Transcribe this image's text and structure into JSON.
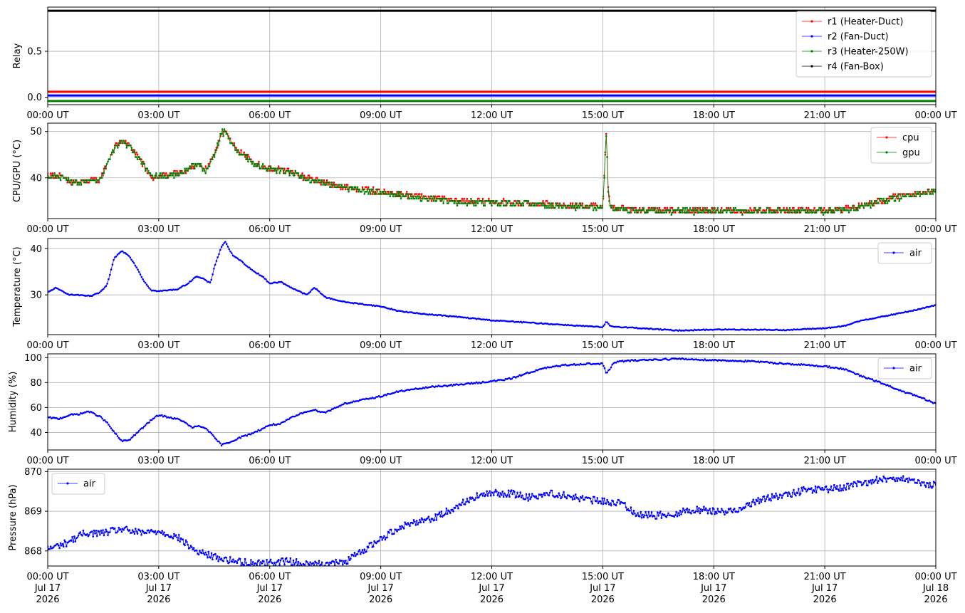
{
  "colors": {
    "red": "#ff0000",
    "blue": "#0000ff",
    "green": "#008000",
    "black": "#000000",
    "grid": "#b0b0b0"
  },
  "x_axis": {
    "ticks_hours": [
      0,
      3,
      6,
      9,
      12,
      15,
      18,
      21,
      24
    ],
    "tick_labels": [
      "00:00 UT",
      "03:00 UT",
      "06:00 UT",
      "09:00 UT",
      "12:00 UT",
      "15:00 UT",
      "18:00 UT",
      "21:00 UT",
      "00:00 UT"
    ],
    "date_lines": [
      "Jul 17",
      "Jul 17",
      "Jul 17",
      "Jul 17",
      "Jul 17",
      "Jul 17",
      "Jul 17",
      "Jul 17",
      "Jul 18"
    ],
    "year_lines": [
      "2026",
      "2026",
      "2026",
      "2026",
      "2026",
      "2026",
      "2026",
      "2026",
      "2026"
    ],
    "xlim_hours": [
      0,
      24
    ]
  },
  "chart_data": [
    {
      "type": "line",
      "ylabel": "Relay",
      "ylim": [
        -0.08,
        0.98
      ],
      "yticks": [
        0.0,
        0.5
      ],
      "ytick_labels": [
        "0.0",
        "0.5"
      ],
      "grid": true,
      "legend_position": "top-right",
      "series": [
        {
          "name": "r1 (Heater-Duct)",
          "color": "#ff0000",
          "style": "flat",
          "x": [
            0,
            24
          ],
          "y": [
            0.06,
            0.06
          ]
        },
        {
          "name": "r2 (Fan-Duct)",
          "color": "#0000ff",
          "style": "flat",
          "x": [
            0,
            24
          ],
          "y": [
            0.02,
            0.02
          ]
        },
        {
          "name": "r3 (Heater-250W)",
          "color": "#008000",
          "style": "flat",
          "x": [
            0,
            24
          ],
          "y": [
            -0.04,
            -0.04
          ]
        },
        {
          "name": "r4 (Fan-Box)",
          "color": "#000000",
          "style": "flat",
          "x": [
            0,
            24
          ],
          "y": [
            0.94,
            0.94
          ]
        }
      ]
    },
    {
      "type": "line",
      "ylabel": "CPU/GPU (°C)",
      "ylim": [
        31.2,
        51.8
      ],
      "yticks": [
        40,
        50
      ],
      "ytick_labels": [
        "40",
        "50"
      ],
      "grid": true,
      "legend_position": "top-right",
      "series": [
        {
          "name": "cpu",
          "color": "#ff0000",
          "style": "dense",
          "noise": 0.6,
          "x": [
            0,
            0.3,
            0.6,
            1.0,
            1.4,
            1.6,
            1.8,
            2.0,
            2.2,
            2.5,
            2.8,
            3.2,
            3.6,
            3.9,
            4.1,
            4.3,
            4.5,
            4.7,
            4.8,
            5.0,
            5.3,
            5.6,
            6.0,
            6.5,
            7.0,
            7.5,
            8.0,
            8.5,
            9.0,
            10.0,
            11.0,
            12.0,
            13.0,
            14.0,
            15.0,
            15.06,
            15.1,
            15.14,
            15.2,
            15.3,
            16.0,
            17.0,
            18.0,
            19.0,
            20.0,
            21.0,
            21.5,
            22.0,
            22.5,
            23.0,
            23.5,
            24.0
          ],
          "y": [
            40.5,
            40.5,
            39.0,
            39.2,
            39.5,
            43.0,
            46.5,
            48.0,
            47.0,
            44.0,
            40.0,
            40.5,
            41.0,
            42.5,
            43.0,
            41.5,
            45.0,
            50.0,
            50.0,
            47.0,
            45.0,
            43.0,
            42.0,
            41.5,
            40.0,
            39.0,
            38.0,
            37.5,
            37.0,
            36.0,
            35.0,
            34.8,
            34.5,
            34.0,
            33.8,
            44.0,
            51.0,
            38.0,
            34.0,
            33.5,
            33.0,
            33.0,
            33.0,
            33.0,
            33.0,
            33.0,
            33.2,
            34.0,
            35.0,
            36.0,
            36.8,
            37.2
          ]
        },
        {
          "name": "gpu",
          "color": "#008000",
          "style": "dense",
          "noise": 0.6,
          "x": [
            0,
            0.3,
            0.6,
            1.0,
            1.4,
            1.6,
            1.8,
            2.0,
            2.2,
            2.5,
            2.8,
            3.2,
            3.6,
            3.9,
            4.1,
            4.3,
            4.5,
            4.7,
            4.8,
            5.0,
            5.3,
            5.6,
            6.0,
            6.5,
            7.0,
            7.5,
            8.0,
            8.5,
            9.0,
            10.0,
            11.0,
            12.0,
            13.0,
            14.0,
            15.0,
            15.06,
            15.1,
            15.14,
            15.2,
            15.3,
            16.0,
            17.0,
            18.0,
            19.0,
            20.0,
            21.0,
            21.5,
            22.0,
            22.5,
            23.0,
            23.5,
            24.0
          ],
          "y": [
            40.3,
            40.3,
            39.2,
            39.0,
            39.3,
            42.8,
            46.3,
            47.8,
            46.8,
            43.8,
            40.2,
            40.3,
            40.8,
            42.3,
            42.8,
            41.3,
            44.8,
            49.8,
            49.8,
            46.8,
            44.8,
            42.8,
            41.8,
            41.3,
            39.8,
            38.8,
            37.8,
            37.3,
            36.8,
            35.8,
            34.8,
            34.6,
            34.3,
            33.8,
            33.6,
            43.8,
            50.8,
            37.8,
            33.8,
            33.3,
            32.8,
            32.8,
            32.8,
            32.8,
            32.8,
            32.8,
            33.0,
            33.8,
            34.8,
            35.8,
            36.6,
            37.0
          ]
        }
      ]
    },
    {
      "type": "line",
      "ylabel": "Temperature (°C)",
      "ylim": [
        21.4,
        42.2
      ],
      "yticks": [
        30,
        40
      ],
      "ytick_labels": [
        "30",
        "40"
      ],
      "grid": true,
      "legend_position": "top-right",
      "series": [
        {
          "name": "air",
          "color": "#0000ff",
          "style": "smooth",
          "noise": 0.1,
          "x": [
            0,
            0.2,
            0.4,
            0.6,
            0.8,
            1.0,
            1.2,
            1.4,
            1.6,
            1.8,
            2.0,
            2.2,
            2.4,
            2.6,
            2.8,
            3.0,
            3.5,
            3.8,
            4.0,
            4.2,
            4.4,
            4.5,
            4.7,
            4.8,
            5.0,
            5.2,
            5.5,
            5.8,
            6.0,
            6.3,
            6.6,
            7.0,
            7.2,
            7.3,
            7.5,
            8.0,
            8.5,
            9.0,
            9.5,
            10.0,
            11.0,
            12.0,
            13.0,
            14.0,
            15.0,
            15.1,
            15.2,
            16.0,
            17.0,
            18.0,
            19.0,
            20.0,
            21.0,
            21.5,
            22.0,
            22.5,
            23.0,
            23.5,
            24.0
          ],
          "y": [
            30.5,
            31.5,
            30.8,
            30.0,
            30.0,
            29.8,
            29.8,
            30.5,
            32.0,
            38.0,
            39.5,
            38.5,
            36.0,
            33.0,
            31.0,
            30.8,
            31.2,
            32.5,
            34.0,
            33.5,
            32.5,
            36.0,
            40.5,
            41.5,
            38.5,
            37.5,
            35.5,
            34.0,
            32.5,
            32.8,
            31.5,
            30.0,
            31.5,
            31.0,
            29.5,
            28.5,
            28.0,
            27.5,
            26.5,
            26.0,
            25.3,
            24.5,
            24.0,
            23.5,
            23.0,
            24.2,
            23.2,
            22.8,
            22.3,
            22.5,
            22.5,
            22.4,
            22.8,
            23.2,
            24.5,
            25.2,
            26.0,
            26.8,
            27.8
          ]
        }
      ]
    },
    {
      "type": "line",
      "ylabel": "Humidity (%)",
      "ylim": [
        26,
        103
      ],
      "yticks": [
        40,
        60,
        80,
        100
      ],
      "ytick_labels": [
        "40",
        "60",
        "80",
        "100"
      ],
      "grid": true,
      "legend_position": "top-right",
      "series": [
        {
          "name": "air",
          "color": "#0000ff",
          "style": "smooth",
          "noise": 0.6,
          "x": [
            0,
            0.3,
            0.6,
            0.9,
            1.1,
            1.4,
            1.6,
            1.8,
            2.0,
            2.2,
            2.5,
            2.8,
            3.0,
            3.3,
            3.6,
            3.9,
            4.1,
            4.3,
            4.5,
            4.7,
            4.9,
            5.2,
            5.5,
            5.8,
            6.0,
            6.3,
            6.6,
            7.0,
            7.2,
            7.5,
            8.0,
            8.5,
            9.0,
            9.5,
            10.0,
            10.5,
            11.0,
            12.0,
            12.5,
            13.0,
            13.5,
            14.0,
            14.5,
            15.0,
            15.1,
            15.3,
            15.5,
            16.0,
            17.0,
            18.0,
            19.0,
            20.0,
            21.0,
            21.5,
            22.0,
            22.5,
            23.0,
            23.5,
            24.0
          ],
          "y": [
            52,
            51,
            54,
            55,
            57,
            53,
            48,
            40,
            33,
            34,
            42,
            50,
            54,
            52,
            50,
            44,
            45,
            43,
            36,
            30,
            32,
            36,
            39,
            43,
            46,
            47,
            52,
            57,
            58,
            56,
            63,
            66,
            69,
            73,
            75,
            77,
            78,
            81,
            83,
            88,
            92,
            94,
            95,
            95,
            87,
            96,
            97,
            98,
            99,
            98,
            97,
            95,
            93,
            91,
            85,
            80,
            74,
            69,
            63
          ]
        }
      ]
    },
    {
      "type": "line",
      "ylabel": "Pressure (hPa)",
      "ylim": [
        867.62,
        870.06
      ],
      "yticks": [
        868,
        869,
        870
      ],
      "ytick_labels": [
        "868",
        "869",
        "870"
      ],
      "grid": true,
      "legend_position": "top-left",
      "series": [
        {
          "name": "air",
          "color": "#0000ff",
          "style": "dense",
          "noise": 0.09,
          "x": [
            0,
            0.5,
            1.0,
            1.5,
            2.0,
            2.5,
            3.0,
            3.5,
            4.0,
            4.5,
            5.0,
            5.5,
            6.0,
            6.5,
            7.0,
            7.5,
            8.0,
            8.5,
            9.0,
            9.5,
            10.0,
            10.5,
            11.0,
            11.5,
            12.0,
            12.5,
            13.0,
            13.5,
            14.0,
            14.5,
            15.0,
            15.5,
            16.0,
            16.5,
            17.0,
            17.5,
            18.0,
            18.5,
            19.0,
            19.5,
            20.0,
            20.5,
            21.0,
            21.5,
            22.0,
            22.5,
            23.0,
            23.5,
            24.0
          ],
          "y": [
            868.05,
            868.2,
            868.45,
            868.45,
            868.55,
            868.45,
            868.5,
            868.35,
            868.0,
            867.85,
            867.75,
            867.7,
            867.7,
            867.75,
            867.65,
            867.7,
            867.7,
            868.0,
            868.3,
            868.6,
            868.75,
            868.85,
            869.1,
            869.35,
            869.45,
            869.45,
            869.35,
            869.45,
            869.4,
            869.3,
            869.25,
            869.2,
            868.9,
            868.9,
            868.95,
            869.05,
            869.0,
            869.0,
            869.2,
            869.35,
            869.4,
            869.55,
            869.55,
            869.6,
            869.7,
            869.8,
            869.85,
            869.7,
            869.65
          ]
        }
      ]
    }
  ]
}
